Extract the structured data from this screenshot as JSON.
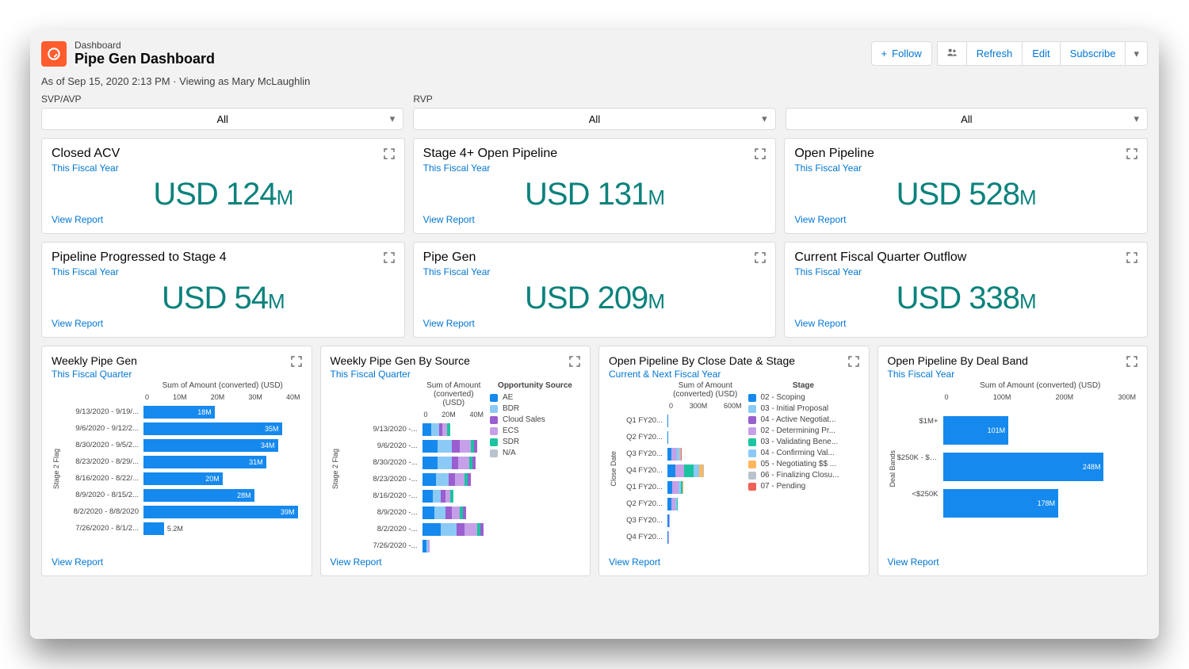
{
  "header": {
    "eyebrow": "Dashboard",
    "title": "Pipe Gen Dashboard",
    "asof": "As of Sep 15, 2020 2:13 PM · Viewing as Mary McLaughlin",
    "follow": "Follow",
    "refresh": "Refresh",
    "edit": "Edit",
    "subscribe": "Subscribe"
  },
  "filters": [
    {
      "label": "SVP/AVP",
      "value": "All"
    },
    {
      "label": "RVP",
      "value": "All"
    },
    {
      "label": "",
      "value": "All"
    }
  ],
  "metric_cards": [
    {
      "title": "Closed ACV",
      "sub": "This Fiscal Year",
      "value": "USD 124",
      "suffix": "M"
    },
    {
      "title": "Stage 4+ Open Pipeline",
      "sub": "This Fiscal Year",
      "value": "USD 131",
      "suffix": "M"
    },
    {
      "title": "Open Pipeline",
      "sub": "This Fiscal Year",
      "value": "USD 528",
      "suffix": "M"
    },
    {
      "title": "Pipeline Progressed to Stage 4",
      "sub": "This Fiscal Year",
      "value": "USD 54",
      "suffix": "M"
    },
    {
      "title": "Pipe Gen",
      "sub": "This Fiscal Year",
      "value": "USD 209",
      "suffix": "M"
    },
    {
      "title": "Current Fiscal Quarter Outflow",
      "sub": "This Fiscal Year",
      "value": "USD 338",
      "suffix": "M"
    }
  ],
  "view_report": "View Report",
  "colors": {
    "blue": "#1589ee",
    "lightblue": "#8bcaf6",
    "purple": "#9a5ecf",
    "lilac": "#c5a0e8",
    "teal": "#1bc4a0",
    "orange": "#ffb75d",
    "red": "#f26155",
    "gray": "#b9c3ce"
  },
  "chart_cards": [
    {
      "title": "Weekly Pipe Gen",
      "sub": "This Fiscal Quarter",
      "axis_title": "Sum of Amount (converted) (USD)",
      "axis_y": "Stage 2 Flag",
      "ticks": [
        "0",
        "10M",
        "20M",
        "30M",
        "40M"
      ],
      "type": "bar_single"
    },
    {
      "title": "Weekly Pipe Gen By Source",
      "sub": "This Fiscal Quarter",
      "axis_title": "Sum of Amount (converted) (USD)",
      "axis_y": "Stage 2 Flag",
      "ticks": [
        "0",
        "20M",
        "40M"
      ],
      "legend_title": "Opportunity Source",
      "type": "bar_stacked"
    },
    {
      "title": "Open Pipeline By Close Date & Stage",
      "sub": "Current & Next Fiscal Year",
      "axis_title": "Sum of Amount (converted) (USD)",
      "axis_y": "Close Date",
      "ticks": [
        "0",
        "300M",
        "600M"
      ],
      "legend_title": "Stage",
      "type": "bar_stacked"
    },
    {
      "title": "Open Pipeline By Deal Band",
      "sub": "This Fiscal Year",
      "axis_title": "Sum of Amount (converted) (USD)",
      "axis_y": "Deal Bands",
      "ticks": [
        "0",
        "100M",
        "200M",
        "300M"
      ],
      "type": "bar_single"
    }
  ],
  "chart_data": [
    {
      "type": "bar",
      "title": "Weekly Pipe Gen",
      "xlabel": "Sum of Amount (converted) (USD)",
      "ylabel": "Stage 2 Flag",
      "xlim": [
        0,
        40
      ],
      "categories": [
        "9/13/2020 - 9/19/...",
        "9/6/2020 - 9/12/2...",
        "8/30/2020 - 9/5/2...",
        "8/23/2020 - 8/29/...",
        "8/16/2020 - 8/22/...",
        "8/9/2020 - 8/15/2...",
        "8/2/2020 - 8/8/2020",
        "7/26/2020 - 8/1/2..."
      ],
      "values": [
        18,
        35,
        34,
        31,
        20,
        28,
        39,
        5.2
      ],
      "value_labels": [
        "18M",
        "35M",
        "34M",
        "31M",
        "20M",
        "28M",
        "39M",
        "5.2M"
      ]
    },
    {
      "type": "bar-stacked",
      "title": "Weekly Pipe Gen By Source",
      "xlabel": "Sum of Amount (converted) (USD)",
      "ylabel": "Stage 2 Flag",
      "xlim": [
        0,
        40
      ],
      "categories": [
        "9/13/2020 -...",
        "9/6/2020 -...",
        "8/30/2020 -...",
        "8/23/2020 -...",
        "8/16/2020 -...",
        "8/9/2020 -...",
        "8/2/2020 -...",
        "7/26/2020 -..."
      ],
      "legend": [
        "AE",
        "BDR",
        "Cloud Sales",
        "ECS",
        "SDR",
        "N/A"
      ],
      "legend_colors": [
        "blue",
        "lightblue",
        "purple",
        "lilac",
        "teal",
        "gray"
      ],
      "series": [
        {
          "cat": "9/13/2020 -...",
          "segs": [
            [
              "blue",
              6
            ],
            [
              "lightblue",
              5
            ],
            [
              "purple",
              2
            ],
            [
              "lilac",
              3
            ],
            [
              "teal",
              2
            ]
          ]
        },
        {
          "cat": "9/6/2020 -...",
          "segs": [
            [
              "blue",
              10
            ],
            [
              "lightblue",
              9
            ],
            [
              "purple",
              5
            ],
            [
              "lilac",
              7
            ],
            [
              "teal",
              2
            ],
            [
              "purple",
              2
            ]
          ]
        },
        {
          "cat": "8/30/2020 -...",
          "segs": [
            [
              "blue",
              10
            ],
            [
              "lightblue",
              9
            ],
            [
              "purple",
              4
            ],
            [
              "lilac",
              7
            ],
            [
              "teal",
              2
            ],
            [
              "purple",
              2
            ]
          ]
        },
        {
          "cat": "8/23/2020 -...",
          "segs": [
            [
              "blue",
              9
            ],
            [
              "lightblue",
              8
            ],
            [
              "purple",
              4
            ],
            [
              "lilac",
              6
            ],
            [
              "teal",
              2
            ],
            [
              "purple",
              2
            ]
          ]
        },
        {
          "cat": "8/16/2020 -...",
          "segs": [
            [
              "blue",
              7
            ],
            [
              "lightblue",
              5
            ],
            [
              "purple",
              3
            ],
            [
              "lilac",
              3
            ],
            [
              "teal",
              2
            ]
          ]
        },
        {
          "cat": "8/9/2020 -...",
          "segs": [
            [
              "blue",
              8
            ],
            [
              "lightblue",
              7
            ],
            [
              "purple",
              4
            ],
            [
              "lilac",
              5
            ],
            [
              "teal",
              2
            ],
            [
              "purple",
              2
            ]
          ]
        },
        {
          "cat": "8/2/2020 -...",
          "segs": [
            [
              "blue",
              12
            ],
            [
              "lightblue",
              10
            ],
            [
              "purple",
              5
            ],
            [
              "lilac",
              8
            ],
            [
              "teal",
              2
            ],
            [
              "purple",
              2
            ]
          ]
        },
        {
          "cat": "7/26/2020 -...",
          "segs": [
            [
              "blue",
              3
            ],
            [
              "lightblue",
              1
            ],
            [
              "lilac",
              1
            ]
          ]
        }
      ]
    },
    {
      "type": "bar-stacked",
      "title": "Open Pipeline By Close Date & Stage",
      "xlabel": "Sum of Amount (converted) (USD)",
      "ylabel": "Close Date",
      "xlim": [
        0,
        600
      ],
      "categories": [
        "Q1 FY20...",
        "Q2 FY20...",
        "Q3 FY20...",
        "Q4 FY20...",
        "Q1 FY20...",
        "Q2 FY20...",
        "Q3 FY20...",
        "Q4 FY20..."
      ],
      "legend": [
        "02 - Scoping",
        "03 - Initial Proposal",
        "04 - Active Negotiat...",
        "02 - Determining Pr...",
        "03 - Validating Bene...",
        "04 - Confirming Val...",
        "05 - Negotiating $$ ...",
        "06 - Finalizing Closu...",
        "07 - Pending"
      ],
      "legend_colors": [
        "blue",
        "lightblue",
        "purple",
        "lilac",
        "teal",
        "lightblue",
        "orange",
        "gray",
        "red"
      ],
      "series": [
        {
          "cat": "Q1 FY20...",
          "segs": [
            [
              "blue",
              2
            ]
          ]
        },
        {
          "cat": "Q2 FY20...",
          "segs": [
            [
              "blue",
              3
            ]
          ]
        },
        {
          "cat": "Q3 FY20...",
          "segs": [
            [
              "blue",
              30
            ],
            [
              "lilac",
              40
            ],
            [
              "lightblue",
              20
            ],
            [
              "gray",
              20
            ],
            [
              "red",
              6
            ]
          ]
        },
        {
          "cat": "Q4 FY20...",
          "segs": [
            [
              "blue",
              60
            ],
            [
              "lilac",
              70
            ],
            [
              "teal",
              80
            ],
            [
              "lightblue",
              40
            ],
            [
              "orange",
              30
            ],
            [
              "gray",
              10
            ]
          ]
        },
        {
          "cat": "Q1 FY20...",
          "segs": [
            [
              "blue",
              40
            ],
            [
              "lilac",
              50
            ],
            [
              "lightblue",
              20
            ],
            [
              "teal",
              10
            ],
            [
              "orange",
              8
            ]
          ]
        },
        {
          "cat": "Q2 FY20...",
          "segs": [
            [
              "blue",
              30
            ],
            [
              "lilac",
              30
            ],
            [
              "lightblue",
              15
            ],
            [
              "teal",
              8
            ]
          ]
        },
        {
          "cat": "Q3 FY20...",
          "segs": [
            [
              "blue",
              10
            ],
            [
              "lilac",
              6
            ]
          ]
        },
        {
          "cat": "Q4 FY20...",
          "segs": [
            [
              "blue",
              8
            ],
            [
              "lilac",
              5
            ]
          ]
        }
      ]
    },
    {
      "type": "bar",
      "title": "Open Pipeline By Deal Band",
      "xlabel": "Sum of Amount (converted) (USD)",
      "ylabel": "Deal Bands",
      "xlim": [
        0,
        300
      ],
      "categories": [
        "$1M+",
        "$250K - $1M",
        "<$250K"
      ],
      "values": [
        101,
        248,
        178
      ],
      "value_labels": [
        "101M",
        "248M",
        "178M"
      ]
    }
  ]
}
